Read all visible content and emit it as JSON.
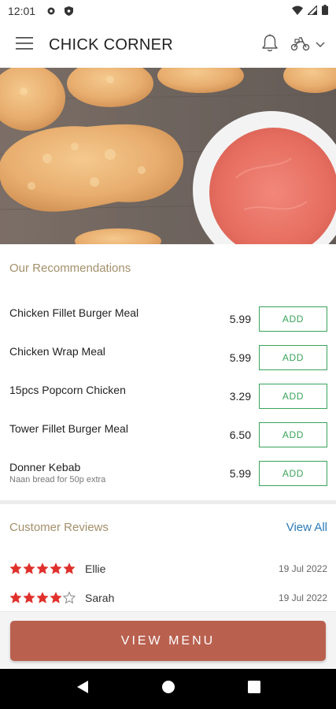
{
  "status_bar": {
    "time": "12:01",
    "icons": [
      "gear-icon",
      "shield-icon",
      "wifi-icon",
      "signal-icon",
      "battery-icon"
    ]
  },
  "app_bar": {
    "title": "CHICK CORNER",
    "icons": [
      "menu-icon",
      "bell-icon",
      "scooter-icon",
      "chevron-down-icon"
    ]
  },
  "hero": {
    "description_icon": "fried-chicken-image"
  },
  "recommendations": {
    "title": "Our Recommendations",
    "items": [
      {
        "name": "Chicken Fillet Burger Meal",
        "price": "5.99",
        "add_label": "ADD"
      },
      {
        "name": "Chicken Wrap Meal",
        "price": "5.99",
        "add_label": "ADD"
      },
      {
        "name": "15pcs Popcorn Chicken",
        "price": "3.29",
        "add_label": "ADD"
      },
      {
        "name": "Tower Fillet Burger Meal",
        "price": "6.50",
        "add_label": "ADD"
      },
      {
        "name": "Donner Kebab",
        "subtitle": "Naan bread for 50p extra",
        "price": "5.99",
        "add_label": "ADD"
      }
    ]
  },
  "reviews": {
    "title": "Customer Reviews",
    "view_all": "View All",
    "items": [
      {
        "name": "Ellie",
        "rating": 5,
        "date": "19 Jul 2022"
      },
      {
        "name": "Sarah",
        "rating": 4,
        "date": "19 Jul 2022"
      }
    ]
  },
  "view_menu_label": "VIEW MENU",
  "colors": {
    "accent": "#b9604f",
    "section_title": "#a38f6a",
    "add_green": "#3aa35a",
    "link_blue": "#2a7ab8",
    "star_red": "#e0302b"
  },
  "nav_bar": {
    "icons": [
      "back-icon",
      "home-icon",
      "recents-icon"
    ]
  }
}
